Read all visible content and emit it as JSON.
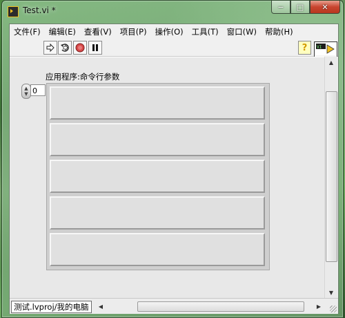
{
  "window": {
    "title": "Test.vi *",
    "icon": "labview-vi-icon",
    "controls": {
      "minimize": "−",
      "maximize": "□",
      "close": "✕"
    }
  },
  "menubar": {
    "items": [
      {
        "label": "文件(F)"
      },
      {
        "label": "编辑(E)"
      },
      {
        "label": "查看(V)"
      },
      {
        "label": "项目(P)"
      },
      {
        "label": "操作(O)"
      },
      {
        "label": "工具(T)"
      },
      {
        "label": "窗口(W)"
      },
      {
        "label": "帮助(H)"
      }
    ]
  },
  "toolbar": {
    "run": "run-arrow-icon",
    "run_continuously": "run-continuously-icon",
    "abort": "abort-stop-icon",
    "pause": "pause-icon",
    "help": "?",
    "connector_pane_number": "1"
  },
  "panel": {
    "array_label": "应用程序:命令行参数",
    "index_value": "0",
    "element_count": 5
  },
  "statusbar": {
    "project_path": "测试.lvproj/我的电脑"
  },
  "colors": {
    "panel_bg": "#e8e8e8",
    "abort_red": "#d84a4a",
    "help_yellow": "#ffffc0"
  }
}
